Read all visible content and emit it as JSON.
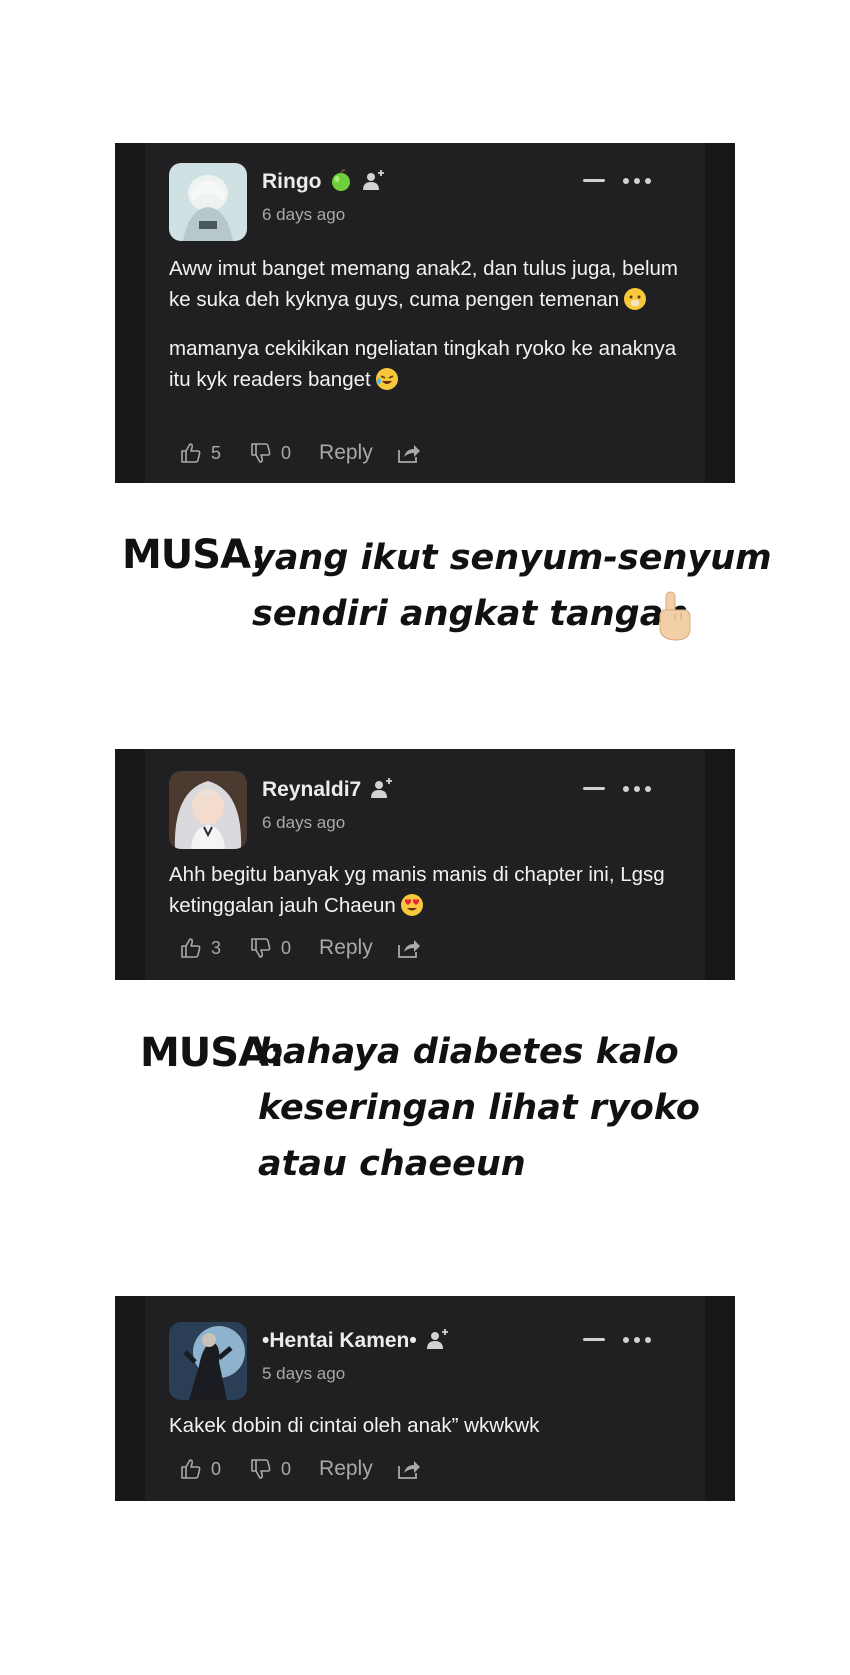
{
  "comments": [
    {
      "username": "Ringo",
      "time": "6 days ago",
      "paragraphs": [
        "Aww imut banget memang anak2, dan tulus juga, belum ke suka deh kyknya guys, cuma pengen temenan",
        "mamanya cekikikan ngeliatan tingkah ryoko ke anaknya itu kyk readers banget"
      ],
      "likes": "5",
      "dislikes": "0",
      "reply_label": "Reply"
    },
    {
      "username": "Reynaldi7",
      "time": "6 days ago",
      "paragraphs": [
        "Ahh begitu banyak yg manis manis di chapter ini, Lgsg ketinggalan jauh Chaeun"
      ],
      "likes": "3",
      "dislikes": "0",
      "reply_label": "Reply"
    },
    {
      "username": "•Hentai Kamen•",
      "time": "5 days ago",
      "paragraphs": [
        "Kakek dobin di cintai oleh anak” wkwkwk"
      ],
      "likes": "0",
      "dislikes": "0",
      "reply_label": "Reply"
    }
  ],
  "musa_notes": [
    {
      "label": "MUSA:",
      "lines": [
        "yang ikut senyum-senyum",
        "sendiri angkat tangan"
      ]
    },
    {
      "label": "MUSA:",
      "lines": [
        "bahaya diabetes kalo",
        "keseringan lihat ryoko",
        "atau chaeeun"
      ]
    }
  ],
  "icons": {
    "badge": "green-apple-icon",
    "follow": "add-user-icon",
    "minimize": "minus-icon",
    "more": "more-dots-icon",
    "like": "thumbs-up-icon",
    "dislike": "thumbs-down-icon",
    "share": "share-icon"
  },
  "colors": {
    "card_outer": "#17171a",
    "card_inner": "#202022",
    "text": "#f2f2f2",
    "muted": "#a9a9ab",
    "apple": "#6fcf3a"
  }
}
